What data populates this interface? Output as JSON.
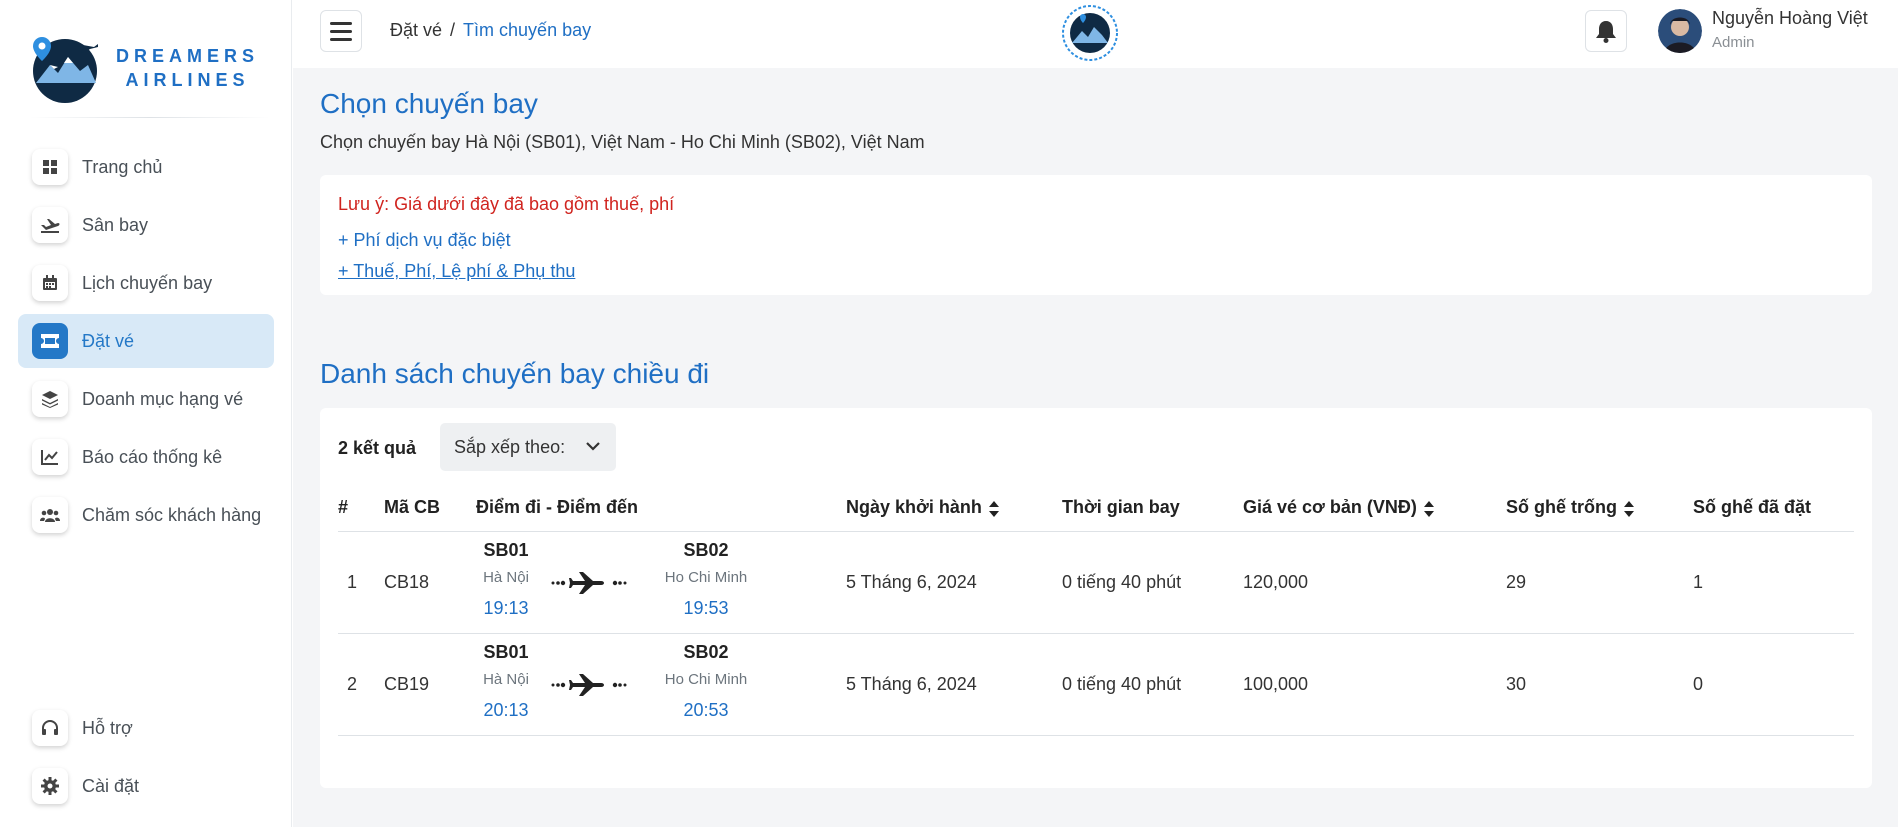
{
  "brand": {
    "line1": "DREAMERS",
    "line2": "AIRLINES"
  },
  "sidebar": {
    "items": [
      {
        "label": "Trang chủ",
        "icon": "home-icon"
      },
      {
        "label": "Sân bay",
        "icon": "plane-departure-icon"
      },
      {
        "label": "Lịch chuyến bay",
        "icon": "calendar-icon"
      },
      {
        "label": "Đặt vé",
        "icon": "ticket-icon",
        "active": true
      },
      {
        "label": "Doanh mục hạng vé",
        "icon": "layers-icon"
      },
      {
        "label": "Báo cáo thống kê",
        "icon": "line-chart-icon"
      },
      {
        "label": "Chăm sóc khách hàng",
        "icon": "users-icon"
      }
    ],
    "bottom": [
      {
        "label": "Hỗ trợ",
        "icon": "headset-icon"
      },
      {
        "label": "Cài đặt",
        "icon": "gear-icon"
      }
    ]
  },
  "header": {
    "breadcrumb": {
      "parent": "Đặt vé",
      "separator": "/",
      "current": "Tìm chuyến bay"
    },
    "user": {
      "name": "Nguyễn Hoàng Việt",
      "role": "Admin"
    }
  },
  "main": {
    "title": "Chọn chuyến bay",
    "subtitle": "Chọn chuyến bay Hà Nội (SB01), Việt Nam - Ho Chi Minh (SB02), Việt Nam",
    "note": {
      "warning": "Lưu ý: Giá dưới đây đã bao gồm thuế, phí",
      "link1": "+ Phí dịch vụ đặc biệt",
      "link2": "+ Thuế, Phí, Lệ phí & Phụ thu"
    },
    "list_title": "Danh sách chuyến bay chiều đi",
    "result_count": "2 kết quả",
    "sort_label": "Sắp xếp theo:",
    "columns": [
      "#",
      "Mã CB",
      "Điểm đi - Điểm đến",
      "Ngày khởi hành",
      "Thời gian bay",
      "Giá vé cơ bản (VNĐ)",
      "Số ghế trống",
      "Số ghế đã đặt"
    ],
    "flights": [
      {
        "idx": "1",
        "code": "CB18",
        "from_code": "SB01",
        "from_city": "Hà Nội",
        "dep": "19:13",
        "to_code": "SB02",
        "to_city": "Ho Chi Minh",
        "arr": "19:53",
        "date": "5 Tháng 6, 2024",
        "duration": "0 tiếng 40 phút",
        "price": "120,000",
        "seats_free": "29",
        "seats_booked": "1"
      },
      {
        "idx": "2",
        "code": "CB19",
        "from_code": "SB01",
        "from_city": "Hà Nội",
        "dep": "20:13",
        "to_code": "SB02",
        "to_city": "Ho Chi Minh",
        "arr": "20:53",
        "date": "5 Tháng 6, 2024",
        "duration": "0 tiếng 40 phút",
        "price": "100,000",
        "seats_free": "30",
        "seats_booked": "0"
      }
    ]
  },
  "colors": {
    "accent": "#1f6fc4",
    "warning": "#d0241f",
    "active_bg": "#d8e9f7"
  }
}
